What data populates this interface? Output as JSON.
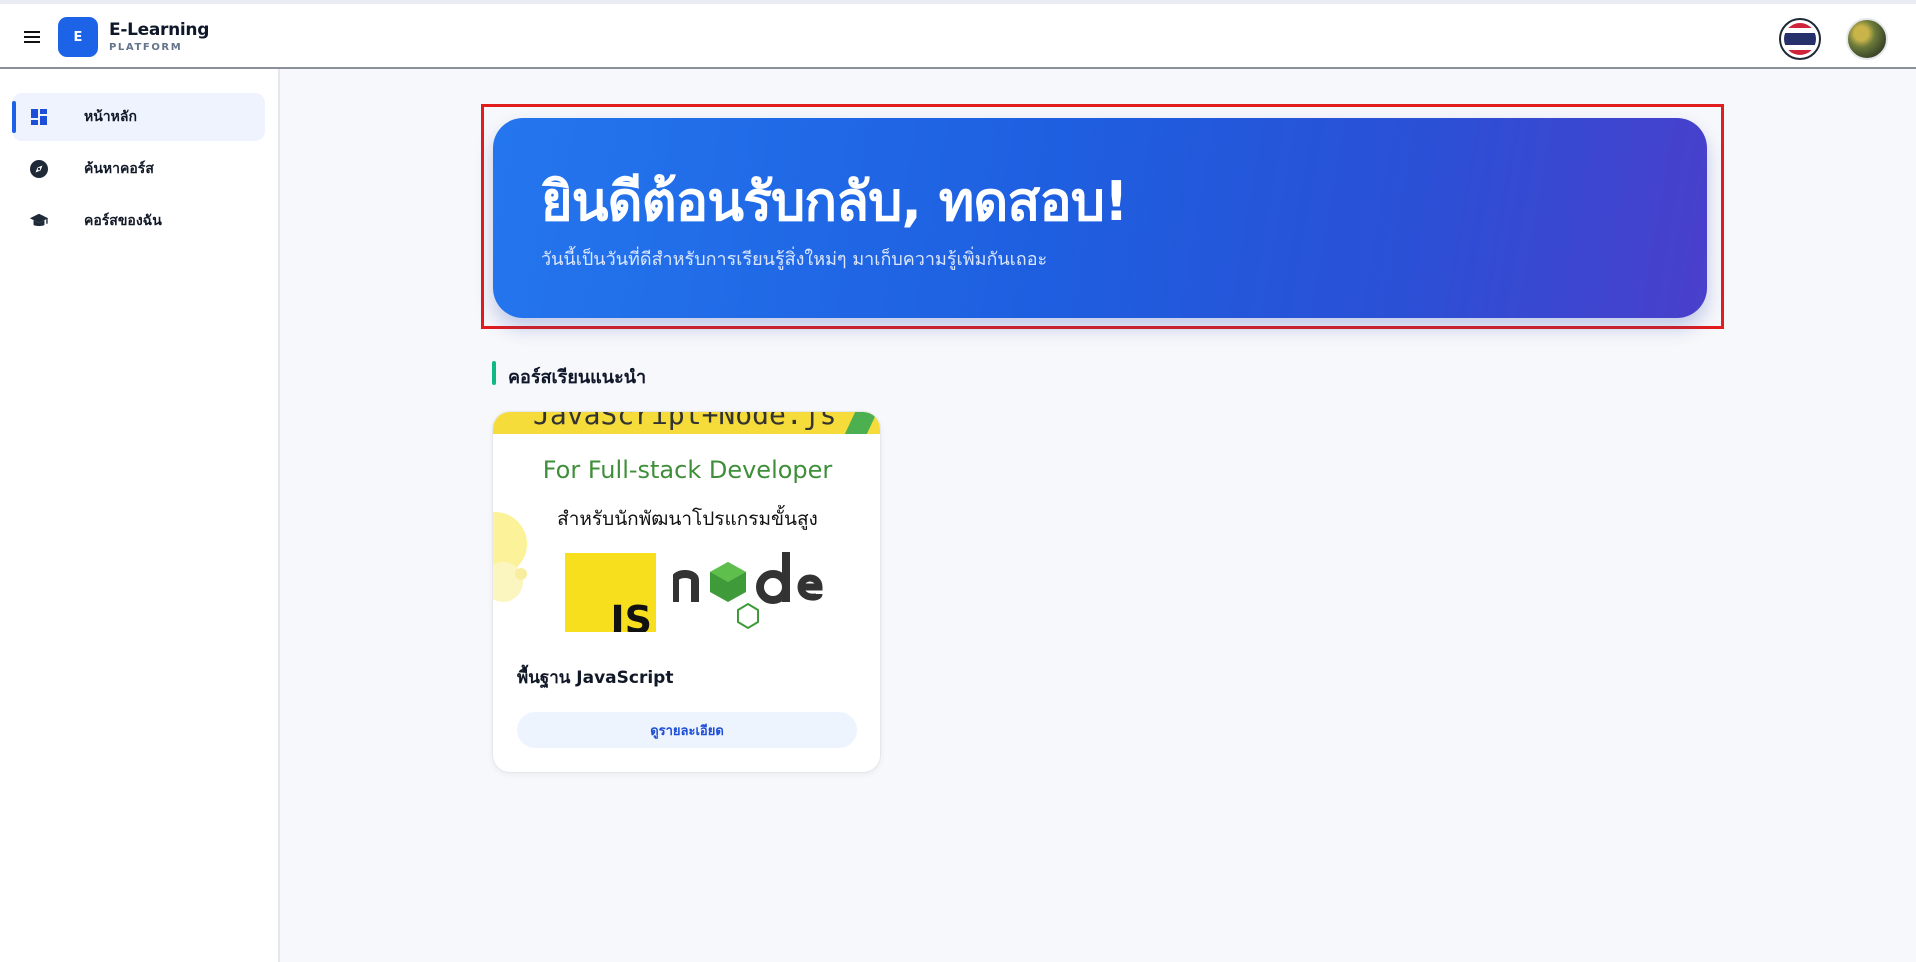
{
  "header": {
    "logo_letter": "E",
    "brand_title": "E-Learning",
    "brand_subtitle": "PLATFORM",
    "language_icon": "thailand-flag-icon",
    "avatar_icon": "user-avatar"
  },
  "sidebar": {
    "items": [
      {
        "label": "หน้าหลัก",
        "icon": "dashboard-icon",
        "active": true
      },
      {
        "label": "ค้นหาคอร์ส",
        "icon": "compass-icon",
        "active": false
      },
      {
        "label": "คอร์สของฉัน",
        "icon": "graduation-cap-icon",
        "active": false
      }
    ]
  },
  "banner": {
    "title": "ยินดีต้อนรับกลับ, ทดสอบ!",
    "subtitle": "วันนี้เป็นวันที่ดีสำหรับการเรียนรู้สิ่งใหม่ๆ มาเก็บความรู้เพิ่มกันเถอะ"
  },
  "recommended": {
    "section_title": "คอร์สเรียนแนะนำ",
    "courses": [
      {
        "thumb_code": "JavaScript+Node.js",
        "thumb_line1": "For Full-stack Developer",
        "thumb_line2": "สำหรับนักพัฒนาโปรแกรมขั้นสูง",
        "js_text": "JS",
        "title": "พื้นฐาน JavaScript",
        "button_label": "ดูรายละเอียด"
      }
    ]
  },
  "colors": {
    "primary": "#1d63e8",
    "section_accent": "#10b981",
    "highlight_border": "#e11d1d"
  }
}
